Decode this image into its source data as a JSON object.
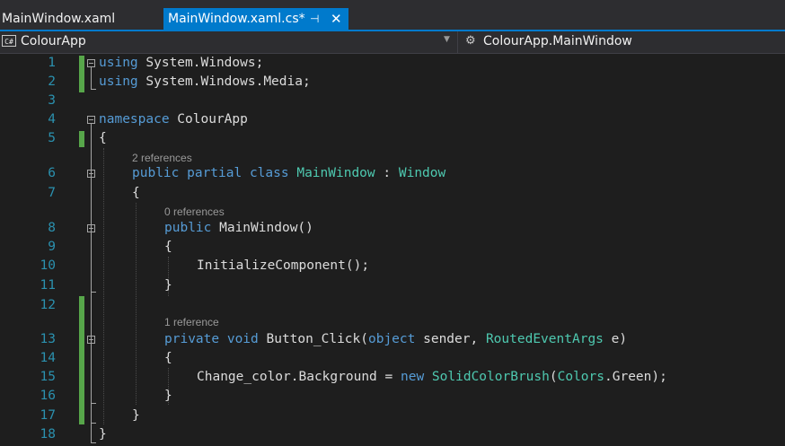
{
  "tabs": [
    {
      "label": "MainWindow.xaml",
      "active": false
    },
    {
      "label": "MainWindow.xaml.cs*",
      "active": true
    }
  ],
  "tab_icons": {
    "pin": "pin-icon",
    "close": "close-icon"
  },
  "nav": {
    "project": "ColourApp",
    "project_icon": "csharp-project-icon",
    "class_scope": "ColourApp.MainWindow",
    "class_icon": "class-icon",
    "lang_badge": "C#"
  },
  "colors": {
    "accent": "#007acc",
    "keyword": "#569cd6",
    "type": "#4ec9b0",
    "line_number": "#2b91af",
    "change_marker": "#57a64a",
    "text": "#dcdcdc",
    "background": "#1e1e1e"
  },
  "line_numbers": [
    "1",
    "2",
    "3",
    "4",
    "5",
    "6",
    "7",
    "8",
    "9",
    "10",
    "11",
    "12",
    "13",
    "14",
    "15",
    "16",
    "17",
    "18"
  ],
  "codelens": {
    "class_refs": "2 references",
    "ctor_refs": "0 references",
    "method_refs": "1 reference"
  },
  "code": {
    "l1": {
      "kw": "using",
      "rest": " System.Windows;"
    },
    "l2": {
      "kw": "using",
      "rest": " System.Windows.Media;"
    },
    "l4": {
      "kw": "namespace",
      "rest": " ColourApp"
    },
    "l5": {
      "text": "{"
    },
    "l6": {
      "kw": "public partial class",
      "sp1": " ",
      "name": "MainWindow",
      "sep": " : ",
      "base": "Window"
    },
    "l7": {
      "text": "{"
    },
    "l8": {
      "kw": "public",
      "rest": " MainWindow()"
    },
    "l9": {
      "text": "{"
    },
    "l10": {
      "text": "InitializeComponent();"
    },
    "l11": {
      "text": "}"
    },
    "l13": {
      "kw1": "private",
      "sp1": " ",
      "kw2": "void",
      "mid": " Button_Click(",
      "kw3": "object",
      "mid2": " sender, ",
      "type": "RoutedEventArgs",
      "end": " e)"
    },
    "l14": {
      "text": "{"
    },
    "l15": {
      "pre": "Change_color.Background = ",
      "kw": "new",
      "sp": " ",
      "type1": "SolidColorBrush",
      "paren": "(",
      "type2": "Colors",
      "post": ".Green);"
    },
    "l16": {
      "text": "}"
    },
    "l17": {
      "text": "}"
    },
    "l18": {
      "text": "}"
    }
  }
}
